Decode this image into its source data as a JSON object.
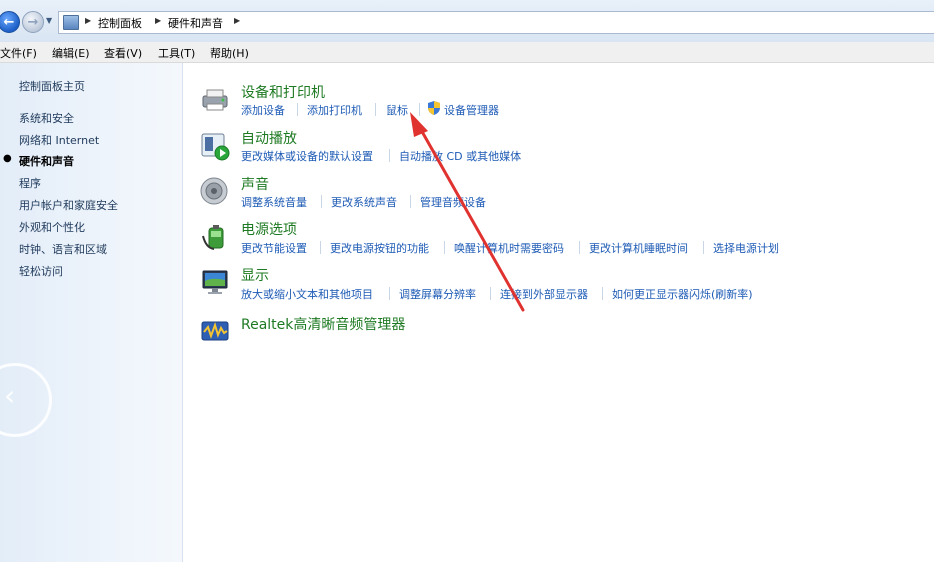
{
  "breadcrumb": {
    "items": [
      "控制面板",
      "硬件和声音"
    ]
  },
  "menu": [
    "文件(F)",
    "编辑(E)",
    "查看(V)",
    "工具(T)",
    "帮助(H)"
  ],
  "sidebar": {
    "home": "控制面板主页",
    "items": [
      "系统和安全",
      "网络和 Internet",
      "硬件和声音",
      "程序",
      "用户帐户和家庭安全",
      "外观和个性化",
      "时钟、语言和区域",
      "轻松访问"
    ],
    "current_index": 2
  },
  "categories": [
    {
      "title": "设备和打印机",
      "icon": "printer-icon",
      "links": [
        "添加设备",
        "添加打印机",
        "鼠标",
        "设备管理器"
      ]
    },
    {
      "title": "自动播放",
      "icon": "autoplay-icon",
      "links": [
        "更改媒体或设备的默认设置",
        "自动播放 CD 或其他媒体"
      ]
    },
    {
      "title": "声音",
      "icon": "speaker-icon",
      "links": [
        "调整系统音量",
        "更改系统声音",
        "管理音频设备"
      ]
    },
    {
      "title": "电源选项",
      "icon": "power-icon",
      "links": [
        "更改节能设置",
        "更改电源按钮的功能",
        "唤醒计算机时需要密码",
        "更改计算机睡眠时间",
        "选择电源计划"
      ]
    },
    {
      "title": "显示",
      "icon": "display-icon",
      "links": [
        "放大或缩小文本和其他项目",
        "调整屏幕分辨率",
        "连接到外部显示器",
        "如何更正显示器闪烁(刷新率)"
      ]
    },
    {
      "title": "Realtek高清晰音频管理器",
      "icon": "realtek-icon",
      "links": []
    }
  ],
  "colors": {
    "category_title": "#1e7a22",
    "link": "#1e5bb5",
    "annotation_arrow": "#e0322f"
  }
}
